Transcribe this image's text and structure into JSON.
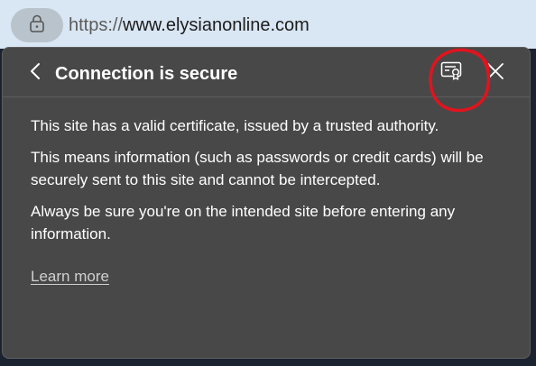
{
  "address_bar": {
    "url_scheme": "https://",
    "url_host": "www.elysianonline.com",
    "lock_icon": "lock-icon"
  },
  "popup": {
    "title": "Connection is secure",
    "back_icon": "chevron-left-icon",
    "certificate_icon": "certificate-icon",
    "close_icon": "close-icon",
    "annotation_color": "#e0141e",
    "paragraphs": [
      "This site has a valid certificate, issued by a trusted authority.",
      "This means information (such as passwords or credit cards) will be securely sent to this site and cannot be intercepted.",
      "Always be sure you're on the intended site before entering any information."
    ],
    "learn_more_label": "Learn more"
  }
}
